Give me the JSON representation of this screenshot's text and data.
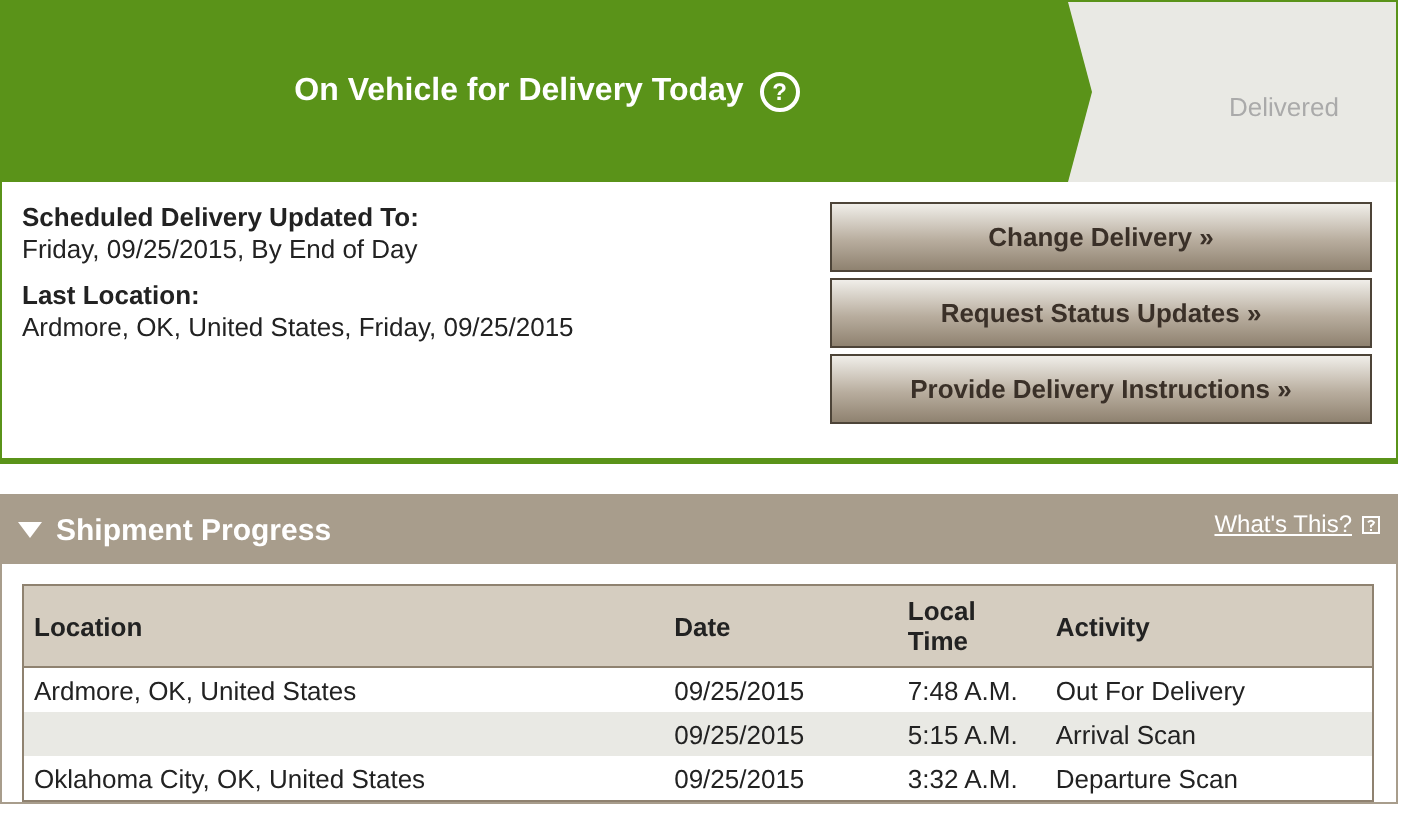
{
  "status_steps": [
    {
      "label": "On Vehicle for Delivery Today",
      "selected": true,
      "help": "?"
    },
    {
      "label": "Delivered",
      "selected": false
    }
  ],
  "details": [
    {
      "label": "Scheduled Delivery Updated To:",
      "value": "Friday, 09/25/2015, By End of Day"
    },
    {
      "label": "Last Location:",
      "value": "Ardmore, OK, United States, Friday, 09/25/2015"
    }
  ],
  "buttons": [
    "Change Delivery »",
    "Request Status Updates »",
    "Provide Delivery Instructions »"
  ],
  "shipment_progress": {
    "title": "Shipment Progress",
    "expanded": true,
    "help_link": "What's This?",
    "table": {
      "columns": [
        "Location",
        "Date",
        "Local Time",
        "Activity"
      ],
      "rows": [
        [
          "Ardmore, OK, United States",
          "09/25/2015",
          "7:48 A.M.",
          "Out For Delivery"
        ],
        [
          "",
          "09/25/2015",
          "5:15 A.M.",
          "Arrival Scan"
        ],
        [
          "Oklahoma City, OK, United States",
          "09/25/2015",
          "3:32 A.M.",
          "Departure Scan"
        ]
      ]
    }
  }
}
